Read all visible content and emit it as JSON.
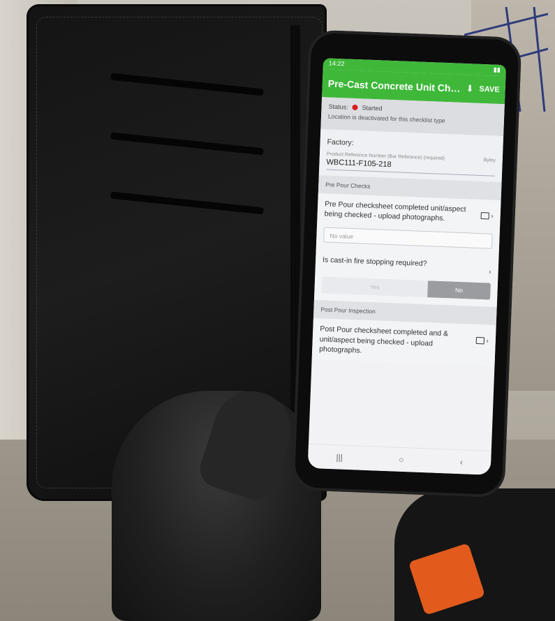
{
  "phone": {
    "time": "14:22",
    "app_title": "Pre-Cast Concrete Unit Check...",
    "save_label": "SAVE",
    "status_label": "Status:",
    "status_value": "Started",
    "location_note": "Location is deactivated for this checklist type",
    "factory_label": "Factory:",
    "ref_label": "Product Reference Number (Bar Reference) (required)",
    "ref_side": "Byley",
    "ref_value": "WBC111-F105-218",
    "section1": "Pre Pour Checks",
    "q1": "Pre Pour checksheet completed unit/aspect being checked - upload photographs.",
    "novalue": "No value",
    "q2": "Is cast-in fire stopping required?",
    "yes_label": "Yes",
    "no_label": "No",
    "selected_option": "No",
    "section2": "Post Pour Inspection",
    "q3": "Post Pour checksheet completed and & unit/aspect being checked - upload photographs.",
    "nav_recent": "|||",
    "nav_home": "○",
    "nav_back": "‹",
    "accent_color": "#3fb83a",
    "status_color": "#d91c1c"
  }
}
